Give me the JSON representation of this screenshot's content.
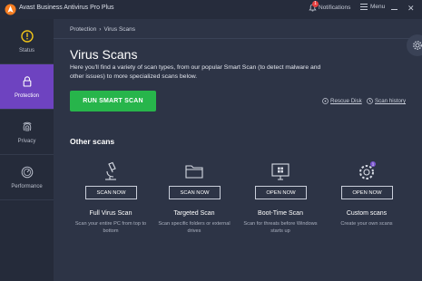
{
  "titlebar": {
    "app_title": "Avast Business Antivirus Pro Plus",
    "notifications_label": "Notifications",
    "notifications_count": "1",
    "menu_label": "Menu",
    "close_glyph": "✕",
    "brand_color": "#f47c20"
  },
  "sidebar": {
    "items": [
      {
        "label": "Status",
        "icon": "exclamation-circle-icon"
      },
      {
        "label": "Protection",
        "icon": "lock-icon"
      },
      {
        "label": "Privacy",
        "icon": "fingerprint-icon"
      },
      {
        "label": "Performance",
        "icon": "speedometer-icon"
      }
    ],
    "active": "Protection",
    "active_color": "#6e43c0"
  },
  "breadcrumb": {
    "items": [
      "Protection",
      "›",
      "Virus Scans"
    ]
  },
  "main": {
    "title": "Virus Scans",
    "description": "Here you'll find a variety of scan types, from our popular Smart Scan (to detect malware and other issues) to more specialized scans below.",
    "run_button": "RUN SMART SCAN",
    "run_button_color": "#27b54b",
    "rescue_disk": "Rescue Disk",
    "scan_history": "Scan history",
    "other_scans_title": "Other scans"
  },
  "scans": [
    {
      "name": "Full Virus Scan",
      "button": "SCAN NOW",
      "description": "Scan your entire PC from top to bottom",
      "icon": "microscope-icon"
    },
    {
      "name": "Targeted Scan",
      "button": "SCAN NOW",
      "description": "Scan specific folders or external drives",
      "icon": "folder-icon"
    },
    {
      "name": "Boot-Time Scan",
      "button": "OPEN NOW",
      "description": "Scan for threats before Windows starts up",
      "icon": "monitor-windows-icon"
    },
    {
      "name": "Custom scans",
      "button": "OPEN NOW",
      "description": "Create your own scans",
      "icon": "gear-scan-icon",
      "badge": "1"
    }
  ]
}
